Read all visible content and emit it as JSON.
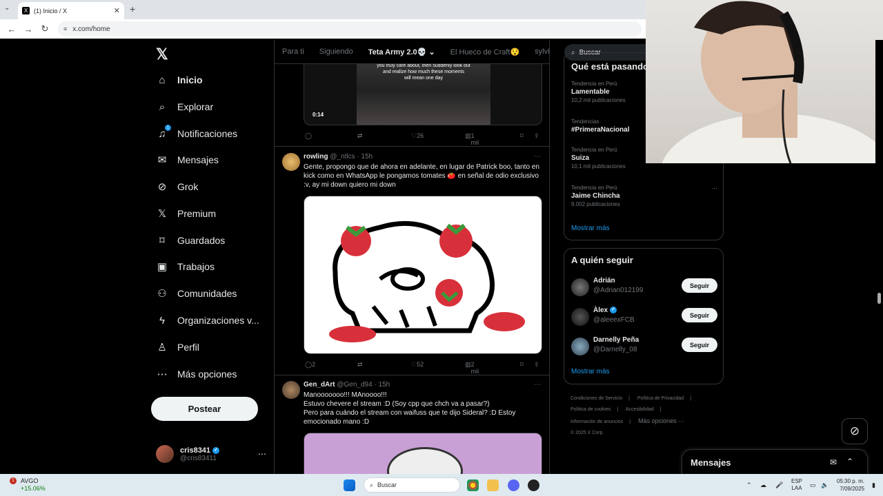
{
  "browser": {
    "tab_title": "(1) Inicio / X",
    "tab_close": "✕",
    "new_tab": "+",
    "url": "x.com/home",
    "url_site_icon": "≡"
  },
  "nav": {
    "logo": "𝕏",
    "items": [
      {
        "label": "Inicio",
        "icon": "home-icon",
        "glyph": "⌂"
      },
      {
        "label": "Explorar",
        "icon": "search-icon",
        "glyph": "⌕"
      },
      {
        "label": "Notificaciones",
        "icon": "bell-icon",
        "glyph": "♫"
      },
      {
        "label": "Mensajes",
        "icon": "mail-icon",
        "glyph": "✉"
      },
      {
        "label": "Grok",
        "icon": "grok-icon",
        "glyph": "⊘"
      },
      {
        "label": "Premium",
        "icon": "x-premium-icon",
        "glyph": "𝕏"
      },
      {
        "label": "Guardados",
        "icon": "bookmark-icon",
        "glyph": "⌑"
      },
      {
        "label": "Trabajos",
        "icon": "briefcase-icon",
        "glyph": "▣"
      },
      {
        "label": "Comunidades",
        "icon": "communities-icon",
        "glyph": "⚇"
      },
      {
        "label": "Organizaciones v...",
        "icon": "lightning-icon",
        "glyph": "ϟ"
      },
      {
        "label": "Perfil",
        "icon": "person-icon",
        "glyph": "♙"
      },
      {
        "label": "Más opciones",
        "icon": "more-circle-icon",
        "glyph": "⋯"
      }
    ],
    "notification_badge": "1",
    "post_button": "Postear",
    "profile": {
      "name": "cris8341",
      "handle": "@cris83411",
      "more": "⋯"
    }
  },
  "timeline": {
    "tabs": [
      "Para ti",
      "Siguiendo",
      "Teta Army 2.0💀",
      "El Hueco de Craft😯",
      "sylville"
    ],
    "selected_tab": "Teta Army 2.0💀",
    "video": {
      "caption_line1": "you truly care about, then suddenly look out",
      "caption_line2": "and realize how much these moments",
      "caption_line3": "will mean one day",
      "time": "0:14"
    },
    "tweet0_actions": {
      "replies": "",
      "reposts": "",
      "likes": "26",
      "views": "1 mil"
    },
    "tweet1": {
      "name": "rowling",
      "handle": "@_ntlcs",
      "time": "· 15h",
      "text": "Gente, propongo que de ahora en adelante, en lugar de Patrick boo, tanto en kick como en WhatsApp le pongamos tomates 🍅 en señal de odio exclusivo :v, ay mi down quiero mi down",
      "actions": {
        "replies": "2",
        "reposts": "",
        "likes": "52",
        "views": "2 mil"
      }
    },
    "tweet2": {
      "name": "Gen_dArt",
      "handle": "@Gen_d94",
      "time": "· 15h",
      "line1": "Manooooooo!!! MAnoooo!!!",
      "line2": "Estuvo chevere el stream :D (Soy cpp que chch va a pasar?)",
      "line3": "Pero para cuándo el stream con waifuss que te dijo Sideral? :D Estoy emocionado mano :D"
    }
  },
  "right": {
    "search_placeholder": "Buscar",
    "trends_heading": "Qué está pasando",
    "trends": [
      {
        "context": "Tendencia en Perú",
        "name": "Lamentable",
        "count": "10,2 mil publicaciones"
      },
      {
        "context": "Tendencias",
        "name": "#PrimeraNacional",
        "count": ""
      },
      {
        "context": "Tendencia en Perú",
        "name": "Suiza",
        "count": "10,1 mil publicaciones"
      },
      {
        "context": "Tendencia en Perú",
        "name": "Jaime Chincha",
        "count": "9.002 publicaciones"
      }
    ],
    "trends_more": "Mostrar más",
    "follow_heading": "A quién seguir",
    "follow": [
      {
        "name": "Adrián",
        "handle": "@Adrian012199",
        "button": "Seguir"
      },
      {
        "name": "Àlex",
        "handle": "@aleeexFCB",
        "button": "Seguir"
      },
      {
        "name": "Darnelly Peña",
        "handle": "@Darnelly_08",
        "button": "Seguir"
      }
    ],
    "follow_more": "Mostrar más",
    "footer": [
      "Condiciones de Servicio",
      "Política de Privacidad",
      "Política de cookies",
      "Accesibilidad",
      "Información de anuncios",
      "Más opciones ···",
      "© 2025 X Corp."
    ]
  },
  "messages_drawer": {
    "title": "Mensajes"
  },
  "taskbar": {
    "stock_name": "AVGO",
    "stock_change": "+15.06%",
    "stock_badge": "1",
    "search": "Buscar",
    "lang_line1": "ESP",
    "lang_line2": "LAA",
    "time": "05:30 p. m.",
    "date": "7/09/2025"
  },
  "colors": {
    "accent": "#1d9bf0",
    "background": "#000000",
    "border": "#2f3336",
    "muted": "#71767b"
  }
}
